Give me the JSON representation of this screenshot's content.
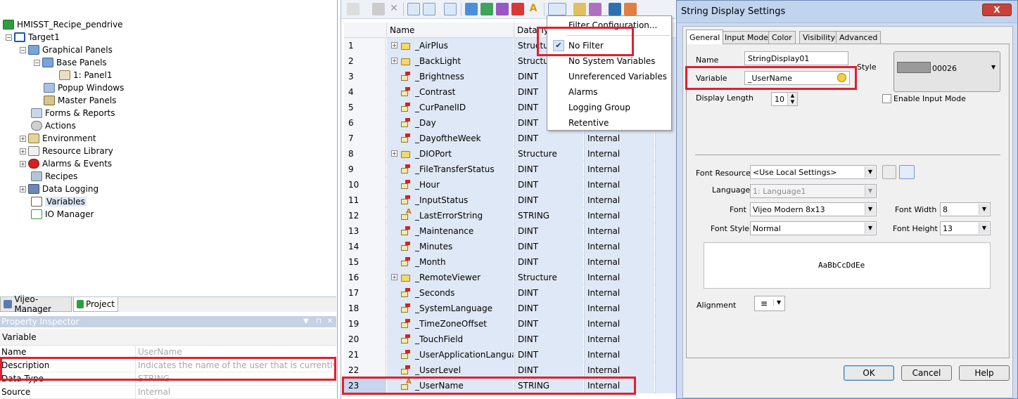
{
  "left": {
    "tree": [
      {
        "label": "HMISST_Recipe_pendrive",
        "icon": "project-root-icon"
      },
      {
        "label": "Target1",
        "icon": "target-icon"
      },
      {
        "label": "Graphical Panels",
        "icon": "graphical-panels-icon"
      },
      {
        "label": "Base Panels",
        "icon": "base-panels-icon"
      },
      {
        "label": "1: Panel1",
        "icon": "panel-icon"
      },
      {
        "label": "Popup Windows",
        "icon": "popup-windows-icon"
      },
      {
        "label": "Master Panels",
        "icon": "master-panels-icon"
      },
      {
        "label": "Forms & Reports",
        "icon": "forms-reports-icon"
      },
      {
        "label": "Actions",
        "icon": "actions-icon"
      },
      {
        "label": "Environment",
        "icon": "environment-icon"
      },
      {
        "label": "Resource Library",
        "icon": "resource-library-icon"
      },
      {
        "label": "Alarms & Events",
        "icon": "alarms-events-icon"
      },
      {
        "label": "Recipes",
        "icon": "recipes-icon"
      },
      {
        "label": "Data Logging",
        "icon": "data-logging-icon"
      },
      {
        "label": "Variables",
        "icon": "variables-icon"
      },
      {
        "label": "IO Manager",
        "icon": "io-manager-icon"
      }
    ],
    "tabs": [
      "Vijeo-Manager",
      "Project"
    ],
    "inspector": {
      "title": "Property Inspector",
      "category": "Variable",
      "rows": [
        {
          "key": "Name",
          "value": "UserName"
        },
        {
          "key": "Description",
          "value": "Indicates the name of the user that is currently logge"
        },
        {
          "key": "Data Type",
          "value": "STRING"
        },
        {
          "key": "Source",
          "value": "Internal"
        }
      ]
    }
  },
  "grid": {
    "headers": [
      "Name",
      "Data Ty",
      ""
    ],
    "rows": [
      {
        "n": "1",
        "name": "_AirPlus",
        "type": "Structure",
        "source": "",
        "kind": "struct"
      },
      {
        "n": "2",
        "name": "_BackLight",
        "type": "Structure",
        "source": "",
        "kind": "struct"
      },
      {
        "n": "3",
        "name": "_Brightness",
        "type": "DINT",
        "source": "",
        "kind": "var"
      },
      {
        "n": "4",
        "name": "_Contrast",
        "type": "DINT",
        "source": "",
        "kind": "var"
      },
      {
        "n": "5",
        "name": "_CurPanelID",
        "type": "DINT",
        "source": "",
        "kind": "var"
      },
      {
        "n": "6",
        "name": "_Day",
        "type": "DINT",
        "source": "",
        "kind": "var"
      },
      {
        "n": "7",
        "name": "_DayoftheWeek",
        "type": "DINT",
        "source": "Internal",
        "kind": "var"
      },
      {
        "n": "8",
        "name": "_DIOPort",
        "type": "Structure",
        "source": "Internal",
        "kind": "struct"
      },
      {
        "n": "9",
        "name": "_FileTransferStatus",
        "type": "DINT",
        "source": "Internal",
        "kind": "var"
      },
      {
        "n": "10",
        "name": "_Hour",
        "type": "DINT",
        "source": "Internal",
        "kind": "var"
      },
      {
        "n": "11",
        "name": "_InputStatus",
        "type": "DINT",
        "source": "Internal",
        "kind": "var"
      },
      {
        "n": "12",
        "name": "_LastErrorString",
        "type": "STRING",
        "source": "Internal",
        "kind": "str"
      },
      {
        "n": "13",
        "name": "_Maintenance",
        "type": "DINT",
        "source": "Internal",
        "kind": "var"
      },
      {
        "n": "14",
        "name": "_Minutes",
        "type": "DINT",
        "source": "Internal",
        "kind": "var"
      },
      {
        "n": "15",
        "name": "_Month",
        "type": "DINT",
        "source": "Internal",
        "kind": "var"
      },
      {
        "n": "16",
        "name": "_RemoteViewer",
        "type": "Structure",
        "source": "Internal",
        "kind": "struct"
      },
      {
        "n": "17",
        "name": "_Seconds",
        "type": "DINT",
        "source": "Internal",
        "kind": "var"
      },
      {
        "n": "18",
        "name": "_SystemLanguage",
        "type": "DINT",
        "source": "Internal",
        "kind": "var"
      },
      {
        "n": "19",
        "name": "_TimeZoneOffset",
        "type": "DINT",
        "source": "Internal",
        "kind": "var"
      },
      {
        "n": "20",
        "name": "_TouchField",
        "type": "DINT",
        "source": "Internal",
        "kind": "var"
      },
      {
        "n": "21",
        "name": "_UserApplicationLanguage",
        "type": "DINT",
        "source": "Internal",
        "kind": "var"
      },
      {
        "n": "22",
        "name": "_UserLevel",
        "type": "DINT",
        "source": "Internal",
        "kind": "var"
      },
      {
        "n": "23",
        "name": "_UserName",
        "type": "STRING",
        "source": "Internal",
        "kind": "str"
      }
    ]
  },
  "filter_menu": {
    "items": [
      "Filter Configuration...",
      "No Filter",
      "No System Variables",
      "Unreferenced Variables",
      "Alarms",
      "Logging Group",
      "Retentive"
    ],
    "checked": "No Filter"
  },
  "dialog": {
    "title": "String Display Settings",
    "close": "X",
    "tabs": [
      "General",
      "Input Mode",
      "Color",
      "Visibility",
      "Advanced"
    ],
    "name_label": "Name",
    "name_value": "StringDisplay01",
    "style_label": "Style",
    "style_value": "00026",
    "variable_label": "Variable",
    "variable_value": "_UserName",
    "display_length_label": "Display Length",
    "display_length_value": "10",
    "enable_input_label": "Enable Input Mode",
    "font_resource_label": "Font Resource",
    "font_resource_value": "<Use Local Settings>",
    "language_label": "Language",
    "language_value": "1: Language1",
    "font_label": "Font",
    "font_value": "Vijeo Modern 8x13",
    "font_width_label": "Font Width",
    "font_width_value": "8",
    "font_style_label": "Font Style",
    "font_style_value": "Normal",
    "font_height_label": "Font Height",
    "font_height_value": "13",
    "preview_text": "AaBbCcDdEe",
    "alignment_label": "Alignment",
    "ok": "OK",
    "cancel": "Cancel",
    "help": "Help"
  },
  "colors": {
    "highlight": "#e0202e",
    "selection": "#dfe8f6"
  }
}
